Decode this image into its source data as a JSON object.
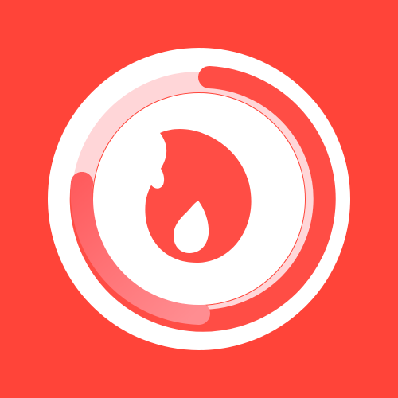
{
  "app_icon": {
    "name": "flame-progress-ring-icon",
    "icon": "flame-icon",
    "progress_percent": 75,
    "colors": {
      "background": "#ff4439",
      "ring_border": "#ffffff",
      "ring_track": "#ffd6d8",
      "progress_primary": "#ff4d45",
      "progress_gradient_end": "#ff8d91",
      "flame": "#ff4d45",
      "flame_core": "#ffffff"
    }
  }
}
